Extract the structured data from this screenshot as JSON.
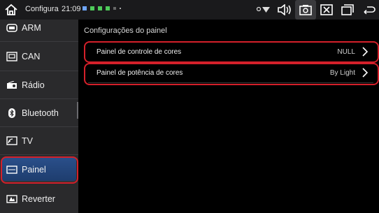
{
  "status_bar": {
    "app_name": "Configura",
    "time": "21:09"
  },
  "sidebar": {
    "items": [
      {
        "label": "ARM",
        "icon": "arm-icon"
      },
      {
        "label": "CAN",
        "icon": "can-icon"
      },
      {
        "label": "Rádio",
        "icon": "radio-icon"
      },
      {
        "label": "Bluetooth",
        "icon": "bluetooth-icon"
      },
      {
        "label": "TV",
        "icon": "tv-icon"
      },
      {
        "label": "Painel",
        "icon": "panel-icon",
        "selected": true
      },
      {
        "label": "Reverter",
        "icon": "reverse-icon"
      }
    ]
  },
  "main": {
    "title": "Configurações do painel",
    "rows": [
      {
        "label": "Painel de controle de cores",
        "value": "NULL"
      },
      {
        "label": "Painel de potência de cores",
        "value": "By Light"
      }
    ]
  },
  "colors": {
    "highlight": "#d4202a",
    "selected_bg": "#2a4f8a",
    "sidebar_bg": "#2a2a2c"
  }
}
